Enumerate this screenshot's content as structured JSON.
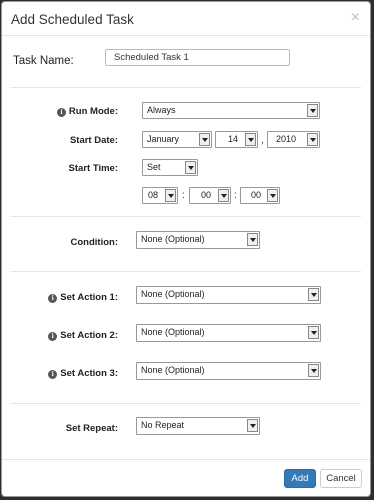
{
  "dialog": {
    "title": "Add Scheduled Task",
    "close_glyph": "×"
  },
  "task_name": {
    "label": "Task Name:",
    "value": "Scheduled Task 1"
  },
  "run_mode": {
    "label": "Run Mode:",
    "value": "Always"
  },
  "start_date": {
    "label": "Start Date:",
    "month": "January",
    "day": "14",
    "year": "2010",
    "separator": ","
  },
  "start_time": {
    "label": "Start Time:",
    "mode": "Set",
    "hour": "08",
    "minute": "00",
    "second": "00",
    "separator": ":"
  },
  "condition": {
    "label": "Condition:",
    "value": "None (Optional)"
  },
  "actions": [
    {
      "label": "Set Action 1:",
      "value": "None (Optional)"
    },
    {
      "label": "Set Action 2:",
      "value": "None (Optional)"
    },
    {
      "label": "Set Action 3:",
      "value": "None (Optional)"
    }
  ],
  "repeat": {
    "label": "Set Repeat:",
    "value": "No Repeat"
  },
  "footer": {
    "add_label": "Add",
    "cancel_label": "Cancel"
  },
  "icons": {
    "info": "info-icon",
    "dropdown": "chevron-down-icon",
    "close": "close-icon"
  },
  "colors": {
    "primary_button": "#337ab7",
    "backdrop": "#2b2f35"
  }
}
